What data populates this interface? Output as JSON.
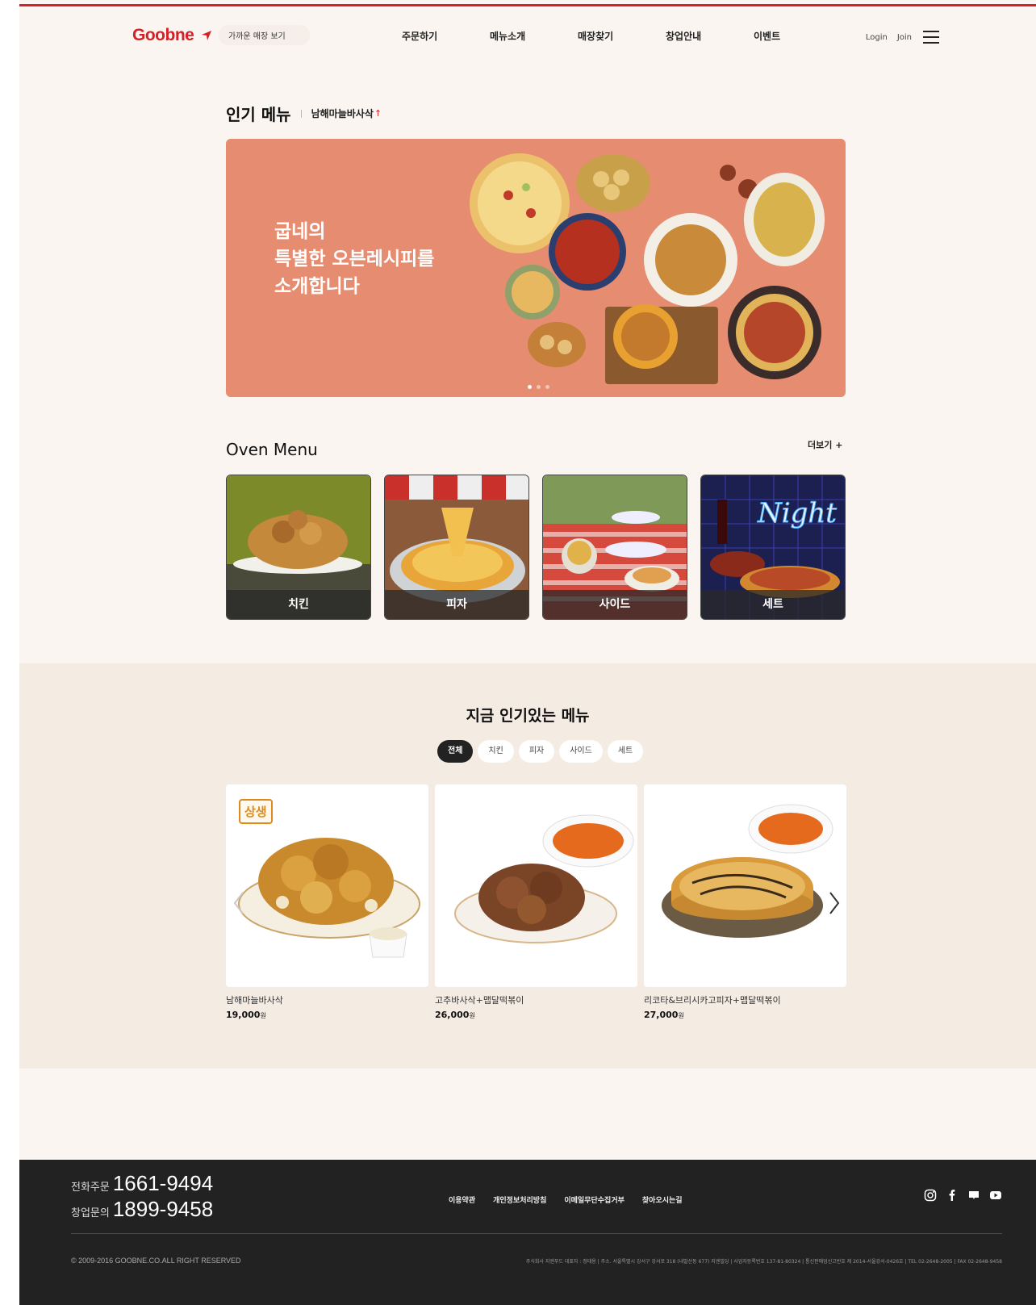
{
  "header": {
    "logo": "Goobne",
    "location_label": "가까운 매장 보기",
    "nav": [
      "주문하기",
      "메뉴소개",
      "매장찾기",
      "창업안내",
      "이벤트"
    ],
    "login": "Login",
    "join": "Join"
  },
  "popular": {
    "title": "인기 메뉴",
    "trending_item": "남해마늘바사삭",
    "banner_lines": [
      "굽네의",
      "특별한 오븐레시피를",
      "소개합니다"
    ]
  },
  "oven_menu": {
    "title": "Oven Menu",
    "more": "더보기 +",
    "items": [
      "치킨",
      "피자",
      "사이드",
      "세트"
    ]
  },
  "hot_menu": {
    "title": "지금 인기있는 메뉴",
    "tabs": [
      "전체",
      "치킨",
      "피자",
      "사이드",
      "세트"
    ],
    "badge": "상생",
    "products": [
      {
        "name": "남해마늘바사삭",
        "price": "19,000",
        "unit": "원"
      },
      {
        "name": "고추바사삭+맵달떡볶이",
        "price": "26,000",
        "unit": "원"
      },
      {
        "name": "리코타&브리시카고피자+맵달떡볶이",
        "price": "27,000",
        "unit": "원"
      }
    ]
  },
  "footer": {
    "order_label": "전화주문",
    "order_phone": "1661-9494",
    "franchise_label": "창업문의",
    "franchise_phone": "1899-9458",
    "links": [
      "이용약관",
      "개인정보처리방침",
      "이메일무단수집거부",
      "찾아오시는길"
    ],
    "copyright": "© 2009-2016 GOOBNE.CO.ALL RIGHT RESERVED",
    "address": "주식회사 지엔푸드 대표자 : 정태용 | 주소. 서울특별시 강서구 강서로 318 (내발산동 677) 지엔빌딩 | 사업자등록번호 137-81-80324 | 통신판매업신고번호 제 2014-서울강서-0426호 | TEL 02-2648-2005 | FAX 02-2648-9458"
  },
  "colors": {
    "brand_red": "#d81f26",
    "banner": "#e68c70",
    "footer_bg": "#222222"
  }
}
